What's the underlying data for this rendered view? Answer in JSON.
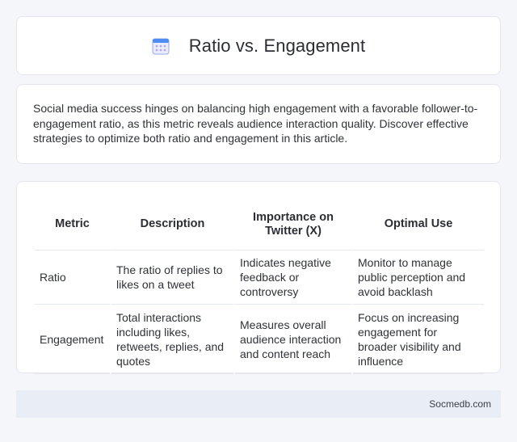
{
  "header": {
    "title": "Ratio vs. Engagement",
    "icon": "calendar-icon"
  },
  "intro": {
    "text": "Social media success hinges on balancing high engagement with a favorable follower-to-engagement ratio, as this metric reveals audience interaction quality. Discover effective strategies to optimize both ratio and engagement in this article."
  },
  "table": {
    "headers": [
      "Metric",
      "Description",
      "Importance on Twitter (X)",
      "Optimal Use"
    ],
    "rows": [
      [
        "Ratio",
        "The ratio of replies to likes on a tweet",
        "Indicates negative feedback or controversy",
        "Monitor to manage public perception and avoid backlash"
      ],
      [
        "Engagement",
        "Total interactions including likes, retweets, replies, and quotes",
        "Measures overall audience interaction and content reach",
        "Focus on increasing engagement for broader visibility and influence"
      ]
    ]
  },
  "footer": {
    "site": "Socmedb.com"
  },
  "colors": {
    "background": "#f5f6fa",
    "card": "#ffffff",
    "footer": "#e9edf6",
    "icon_accent": "#4f8df5"
  }
}
